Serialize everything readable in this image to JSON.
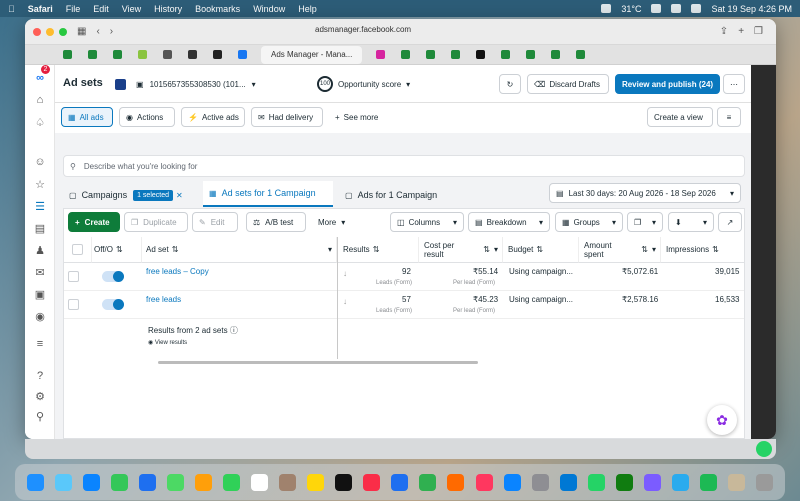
{
  "menubar": {
    "apple": "",
    "items": [
      "Safari",
      "File",
      "Edit",
      "View",
      "History",
      "Bookmarks",
      "Window",
      "Help"
    ],
    "temp": "31°C",
    "datetime": "Sat 19 Sep 4:26 PM"
  },
  "browser": {
    "address": "adsmanager.facebook.com",
    "active_tab": "Ads Manager - Mana..."
  },
  "header": {
    "title": "Ad sets",
    "account": "1015657355308530 (101...",
    "opportunity": "Opportunity score",
    "score": "100",
    "discard": "Discard Drafts",
    "publish": "Review and publish (24)"
  },
  "filters": {
    "all_ads": "All ads",
    "actions": "Actions",
    "active": "Active ads",
    "delivery": "Had delivery",
    "see_more": "See more",
    "create_view": "Create a view"
  },
  "search": {
    "placeholder": "Describe what you're looking for"
  },
  "tabs": {
    "campaigns": "Campaigns",
    "selected": "1 selected",
    "adsets": "Ad sets for 1 Campaign",
    "ads": "Ads for 1 Campaign",
    "date": "Last 30 days: 20 Aug 2026 - 18 Sep 2026"
  },
  "toolbar": {
    "create": "Create",
    "duplicate": "Duplicate",
    "edit": "Edit",
    "ab": "A/B test",
    "more": "More",
    "columns": "Columns",
    "breakdown": "Breakdown",
    "groups": "Groups"
  },
  "table": {
    "headers": {
      "off": "Off/O",
      "adset": "Ad set",
      "results": "Results",
      "cost": "Cost per",
      "cost2": "result",
      "budget": "Budget",
      "amount": "Amount",
      "amount2": "spent",
      "impressions": "Impressions"
    },
    "rows": [
      {
        "name": "free leads – Copy",
        "results": "92",
        "results_sub": "Leads (Form)",
        "cost": "₹55.14",
        "cost_sub": "Per lead (Form)",
        "budget": "Using campaign...",
        "spent": "₹5,072.61",
        "impressions": "39,015"
      },
      {
        "name": "free leads",
        "results": "57",
        "results_sub": "Leads (Form)",
        "cost": "₹45.23",
        "cost_sub": "Per lead (Form)",
        "budget": "Using campaign...",
        "spent": "₹2,578.16",
        "impressions": "16,533"
      }
    ],
    "footer": "Results from 2 ad sets",
    "view": "View results"
  }
}
